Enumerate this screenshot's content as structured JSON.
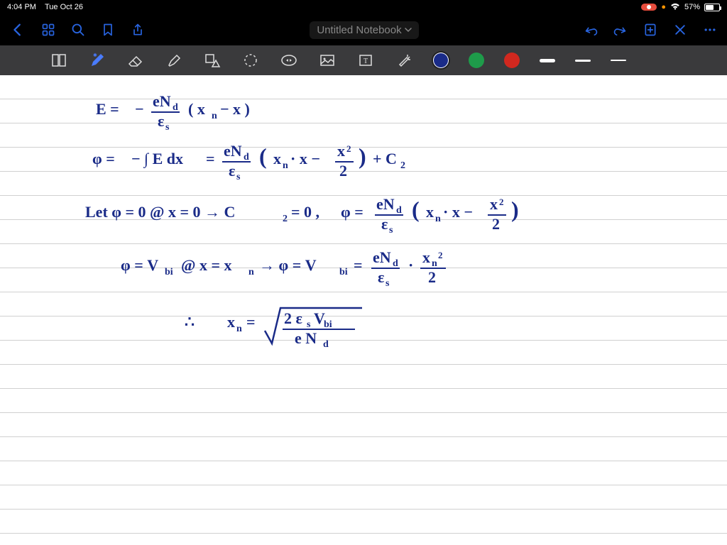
{
  "status": {
    "time": "4:04 PM",
    "date": "Tue Oct 26",
    "battery_pct": "57%",
    "battery_fill_pct": 57
  },
  "nav": {
    "title": "Untitled Notebook"
  },
  "toolbar": {
    "colors": {
      "c1": "#1a2b88",
      "c2": "#1e9b4a",
      "c3": "#d1281f"
    }
  },
  "notes": {
    "line1": "E = − eN_d / ε_s ( x_n − x )",
    "line2": "φ = − ∫ E dx = eN_d / ε_s ( x_n · x − x² / 2 ) + C₂",
    "line3": "Let φ = 0 @ x = 0 → C₂ = 0 ,  φ = eN_d / ε_s ( x_n · x − x² / 2 )",
    "line4": "φ = V_bi @ x = x_n →  φ = V_bi = eN_d / ε_s · x_n² / 2",
    "line5": "∴   x_n = √( 2 ε_s V_bi / e N_d )"
  }
}
